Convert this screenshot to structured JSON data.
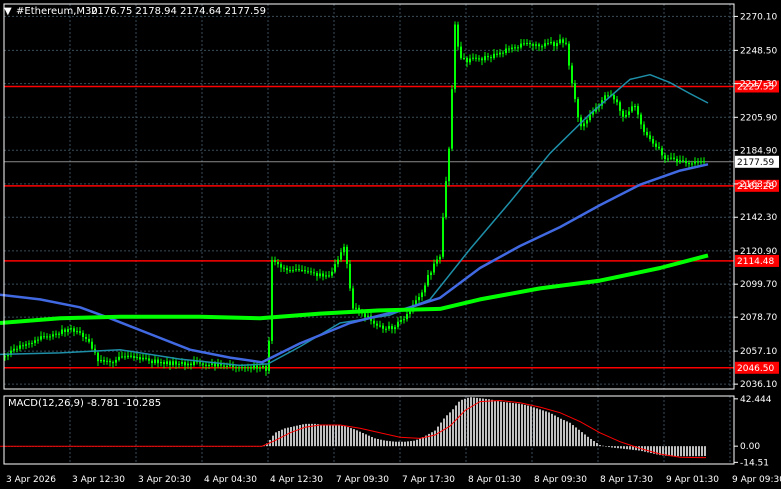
{
  "header": {
    "symbol": "#Ethereum,M30",
    "ohlc": "2176.75 2178.94 2174.64 2177.59"
  },
  "colors": {
    "background": "#000000",
    "candle": "#00ff00",
    "grid": "#3a4d5a",
    "level": "#ff0000",
    "ma_fast": "#1e8fa8",
    "ma_mid": "#4169e1",
    "ma_slow": "#00ff00",
    "macd_hist": "#c0c0c0",
    "macd_signal": "#ff0000"
  },
  "chart_data": [
    {
      "type": "candlestick",
      "title": "#Ethereum,M30",
      "y_ticks": [
        "2270.10",
        "2248.50",
        "2227.30",
        "2205.90",
        "2184.90",
        "2163.50",
        "2142.30",
        "2120.90",
        "2099.70",
        "2078.70",
        "2057.10",
        "2036.10"
      ],
      "ylim": [
        2033,
        2278
      ],
      "x_ticks": [
        "3 Apr 2026",
        "3 Apr 12:30",
        "3 Apr 20:30",
        "4 Apr 04:30",
        "4 Apr 12:30",
        "7 Apr 09:30",
        "7 Apr 17:30",
        "8 Apr 01:30",
        "8 Apr 09:30",
        "8 Apr 17:30",
        "9 Apr 01:30",
        "9 Apr 09:30"
      ],
      "current_price": "2177.59",
      "levels": [
        {
          "value": 2225.5,
          "label": "2225.55"
        },
        {
          "value": 2162.3,
          "label": "2162.28"
        },
        {
          "value": 2114.5,
          "label": "2114.48"
        },
        {
          "value": 2046.5,
          "label": "2046.50"
        }
      ],
      "price_path": [
        [
          0,
          2052
        ],
        [
          20,
          2060
        ],
        [
          40,
          2065
        ],
        [
          55,
          2068
        ],
        [
          70,
          2072
        ],
        [
          85,
          2066
        ],
        [
          100,
          2050
        ],
        [
          130,
          2053
        ],
        [
          160,
          2050
        ],
        [
          200,
          2049
        ],
        [
          240,
          2047
        ],
        [
          268,
          2046
        ],
        [
          272,
          2115
        ],
        [
          290,
          2108
        ],
        [
          310,
          2107
        ],
        [
          330,
          2104
        ],
        [
          345,
          2125
        ],
        [
          352,
          2085
        ],
        [
          365,
          2080
        ],
        [
          380,
          2072
        ],
        [
          392,
          2072
        ],
        [
          405,
          2078
        ],
        [
          420,
          2092
        ],
        [
          432,
          2110
        ],
        [
          440,
          2118
        ],
        [
          450,
          2195
        ],
        [
          455,
          2265
        ],
        [
          460,
          2242
        ],
        [
          475,
          2243
        ],
        [
          495,
          2245
        ],
        [
          510,
          2250
        ],
        [
          530,
          2253
        ],
        [
          550,
          2252
        ],
        [
          565,
          2255
        ],
        [
          572,
          2228
        ],
        [
          580,
          2200
        ],
        [
          595,
          2210
        ],
        [
          605,
          2220
        ],
        [
          615,
          2218
        ],
        [
          625,
          2205
        ],
        [
          635,
          2214
        ],
        [
          645,
          2195
        ],
        [
          655,
          2188
        ],
        [
          665,
          2180
        ],
        [
          680,
          2177
        ],
        [
          700,
          2177
        ],
        [
          706,
          2177.59
        ]
      ],
      "series": [
        {
          "name": "",
          "color": "#1e8fa8",
          "points": [
            [
              0,
              2055
            ],
            [
              60,
              2056
            ],
            [
              120,
              2058
            ],
            [
              180,
              2052
            ],
            [
              240,
              2048
            ],
            [
              268,
              2049
            ],
            [
              300,
              2060
            ],
            [
              340,
              2075
            ],
            [
              390,
              2080
            ],
            [
              430,
              2090
            ],
            [
              470,
              2122
            ],
            [
              510,
              2152
            ],
            [
              550,
              2183
            ],
            [
              590,
              2208
            ],
            [
              630,
              2230
            ],
            [
              650,
              2233
            ],
            [
              670,
              2228
            ],
            [
              690,
              2221
            ],
            [
              708,
              2215
            ]
          ]
        },
        {
          "name": "",
          "color": "#4169e1",
          "points": [
            [
              0,
              2093
            ],
            [
              40,
              2090
            ],
            [
              80,
              2085
            ],
            [
              110,
              2078
            ],
            [
              150,
              2068
            ],
            [
              190,
              2058
            ],
            [
              230,
              2053
            ],
            [
              262,
              2050
            ],
            [
              300,
              2062
            ],
            [
              350,
              2075
            ],
            [
              400,
              2083
            ],
            [
              440,
              2091
            ],
            [
              480,
              2110
            ],
            [
              520,
              2124
            ],
            [
              560,
              2136
            ],
            [
              600,
              2150
            ],
            [
              640,
              2163
            ],
            [
              680,
              2172
            ],
            [
              708,
              2176
            ]
          ]
        },
        {
          "name": "",
          "color": "#00ff00",
          "points": [
            [
              0,
              2075
            ],
            [
              60,
              2078
            ],
            [
              120,
              2079
            ],
            [
              200,
              2079
            ],
            [
              260,
              2078
            ],
            [
              320,
              2081
            ],
            [
              380,
              2083
            ],
            [
              440,
              2084
            ],
            [
              480,
              2090
            ],
            [
              540,
              2097
            ],
            [
              600,
              2102
            ],
            [
              660,
              2110
            ],
            [
              708,
              2118
            ]
          ]
        }
      ]
    },
    {
      "type": "bar",
      "title": "MACD(12,26,9) -8.781 -10.285",
      "indicator": "MACD(12,26,9)",
      "main_value": "-8.781",
      "signal_value": "-10.285",
      "y_ticks": [
        "42.444",
        "0.00",
        "-14.51"
      ],
      "ylim": [
        -16,
        45
      ],
      "histogram": [
        [
          0,
          0
        ],
        [
          40,
          0
        ],
        [
          80,
          0
        ],
        [
          120,
          0
        ],
        [
          160,
          0
        ],
        [
          200,
          0
        ],
        [
          240,
          0
        ],
        [
          262,
          0
        ],
        [
          268,
          3
        ],
        [
          275,
          12
        ],
        [
          285,
          16
        ],
        [
          295,
          18
        ],
        [
          305,
          20
        ],
        [
          315,
          20
        ],
        [
          325,
          19
        ],
        [
          335,
          19
        ],
        [
          345,
          18
        ],
        [
          355,
          15
        ],
        [
          365,
          11
        ],
        [
          375,
          7
        ],
        [
          385,
          5
        ],
        [
          395,
          4
        ],
        [
          405,
          4
        ],
        [
          415,
          5
        ],
        [
          425,
          9
        ],
        [
          435,
          14
        ],
        [
          445,
          26
        ],
        [
          452,
          32
        ],
        [
          460,
          41
        ],
        [
          470,
          44
        ],
        [
          480,
          43
        ],
        [
          490,
          42
        ],
        [
          500,
          40
        ],
        [
          510,
          39
        ],
        [
          520,
          38
        ],
        [
          530,
          36
        ],
        [
          540,
          33
        ],
        [
          550,
          30
        ],
        [
          560,
          25
        ],
        [
          570,
          21
        ],
        [
          580,
          14
        ],
        [
          590,
          7
        ],
        [
          600,
          1
        ],
        [
          610,
          -1
        ],
        [
          620,
          -2
        ],
        [
          630,
          -3
        ],
        [
          640,
          -4
        ],
        [
          650,
          -6
        ],
        [
          660,
          -8
        ],
        [
          670,
          -9
        ],
        [
          680,
          -9
        ],
        [
          690,
          -9
        ],
        [
          700,
          -9
        ],
        [
          706,
          -8.8
        ]
      ],
      "signal": [
        [
          0,
          0
        ],
        [
          262,
          0
        ],
        [
          275,
          5
        ],
        [
          290,
          12
        ],
        [
          305,
          17
        ],
        [
          320,
          19
        ],
        [
          340,
          19
        ],
        [
          360,
          16
        ],
        [
          380,
          12
        ],
        [
          400,
          8
        ],
        [
          420,
          7
        ],
        [
          435,
          10
        ],
        [
          450,
          18
        ],
        [
          465,
          32
        ],
        [
          480,
          40
        ],
        [
          500,
          41
        ],
        [
          520,
          39
        ],
        [
          540,
          35
        ],
        [
          560,
          30
        ],
        [
          580,
          22
        ],
        [
          600,
          12
        ],
        [
          620,
          4
        ],
        [
          640,
          -2
        ],
        [
          660,
          -7
        ],
        [
          680,
          -10
        ],
        [
          700,
          -10.3
        ],
        [
          706,
          -10.285
        ]
      ]
    }
  ]
}
